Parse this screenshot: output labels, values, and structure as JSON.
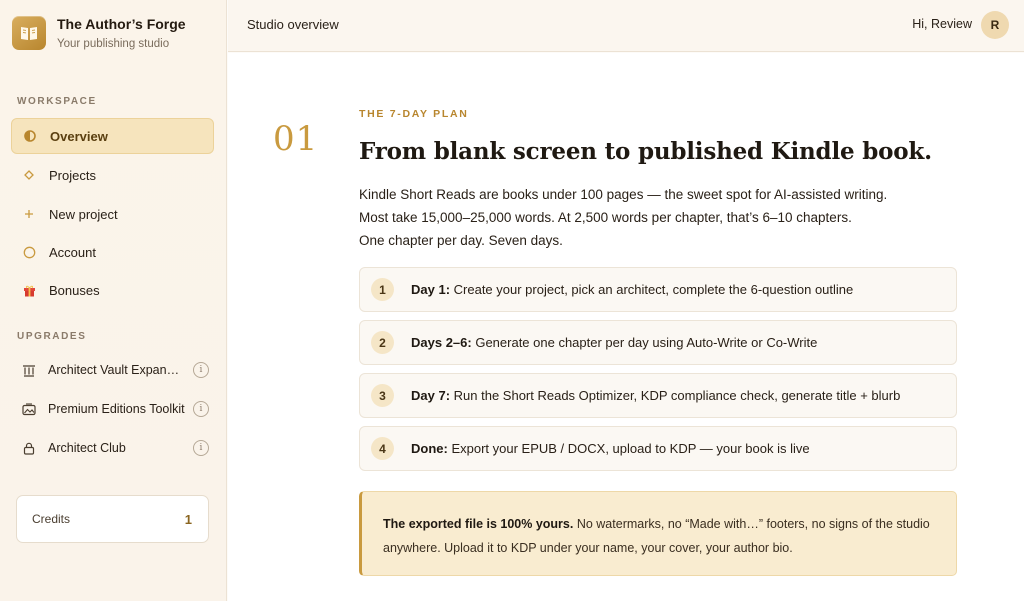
{
  "brand": {
    "title": "The Author’s Forge",
    "subtitle": "Your publishing studio"
  },
  "sidebar": {
    "workspace_label": "WORKSPACE",
    "items": [
      {
        "label": "Overview",
        "icon": "half-circle-icon",
        "active": true
      },
      {
        "label": "Projects",
        "icon": "diamond-icon"
      },
      {
        "label": "New project",
        "icon": "plus-icon"
      },
      {
        "label": "Account",
        "icon": "circle-icon"
      },
      {
        "label": "Bonuses",
        "icon": "gift-icon"
      }
    ],
    "upgrades_label": "UPGRADES",
    "upgrades": [
      {
        "label": "Architect Vault Expansion",
        "icon": "columns-icon"
      },
      {
        "label": "Premium Editions Toolkit",
        "icon": "image-frame-icon"
      },
      {
        "label": "Architect Club",
        "icon": "lock-icon"
      }
    ],
    "credits": {
      "label": "Credits",
      "value": "1"
    }
  },
  "topbar": {
    "title": "Studio overview",
    "greeting": "Hi, Review",
    "avatar_initial": "R"
  },
  "main": {
    "step_number": "01",
    "eyebrow": "THE 7-DAY PLAN",
    "headline": "From blank screen to published Kindle book.",
    "intro_lines": [
      "Kindle Short Reads are books under 100 pages — the sweet spot for AI-assisted writing.",
      "Most take 15,000–25,000 words. At 2,500 words per chapter, that’s 6–10 chapters.",
      "One chapter per day. Seven days."
    ],
    "steps": [
      {
        "num": "1",
        "bold": "Day 1:",
        "text": " Create your project, pick an architect, complete the 6-question outline"
      },
      {
        "num": "2",
        "bold": "Days 2–6:",
        "text": " Generate one chapter per day using Auto-Write or Co-Write"
      },
      {
        "num": "3",
        "bold": "Day 7:",
        "text": " Run the Short Reads Optimizer, KDP compliance check, generate title + blurb"
      },
      {
        "num": "4",
        "bold": "Done:",
        "text": " Export your EPUB / DOCX, upload to KDP — your book is live"
      }
    ],
    "callout": {
      "bold": "The exported file is 100% yours.",
      "text": " No watermarks, no “Made with…” footers, no signs of the studio anywhere. Upload it to KDP under your name, your cover, your author bio."
    }
  },
  "colors": {
    "accent": "#c99a3f",
    "active_bg": "#f6e4bd",
    "callout_bg": "#f9ecd0"
  }
}
